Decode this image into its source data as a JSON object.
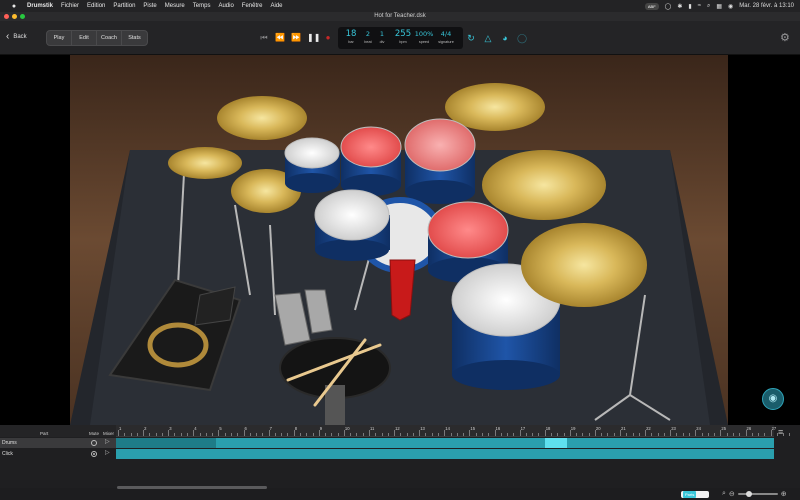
{
  "menubar": {
    "app": "Drumstik",
    "items": [
      "Fichier",
      "Edition",
      "Partition",
      "Piste",
      "Mesure",
      "Temps",
      "Audio",
      "Fenêtre",
      "Aide"
    ],
    "badge": "ABF",
    "datetime": "Mar. 28 févr. à 13:10"
  },
  "window": {
    "title": "Hot for Teacher.dsk"
  },
  "toolbar": {
    "back_label": "Back",
    "modes": [
      "Play",
      "Edit",
      "Coach",
      "Stats"
    ],
    "display": {
      "bar": {
        "value": "18",
        "label": "bar"
      },
      "beat": {
        "value": "2",
        "label": "beat"
      },
      "div": {
        "value": "1",
        "label": "div"
      },
      "bpm": {
        "value": "255",
        "label": "bpm"
      },
      "speed": {
        "value": "100%",
        "label": "speed"
      },
      "signature": {
        "value": "4/4",
        "label": "signature"
      }
    }
  },
  "tracks": {
    "headers": {
      "part": "Part",
      "mute": "Mute",
      "mixer": "Mixer"
    },
    "rows": [
      {
        "name": "Drums",
        "muted": false
      },
      {
        "name": "Click",
        "muted": true
      }
    ],
    "ruler": [
      "1",
      "2",
      "3",
      "4",
      "5",
      "6",
      "7",
      "8",
      "9",
      "10",
      "11",
      "12",
      "13",
      "14",
      "15",
      "16",
      "17",
      "18",
      "19",
      "20",
      "21",
      "22",
      "23",
      "24",
      "25",
      "26",
      "27"
    ],
    "playhead_bar": 18
  },
  "bottom": {
    "parts_label": "Parts"
  },
  "colors": {
    "accent": "#38c6d9",
    "record": "#c62828",
    "lane": "#2a9fad",
    "lane_dark": "#1e7c88"
  }
}
